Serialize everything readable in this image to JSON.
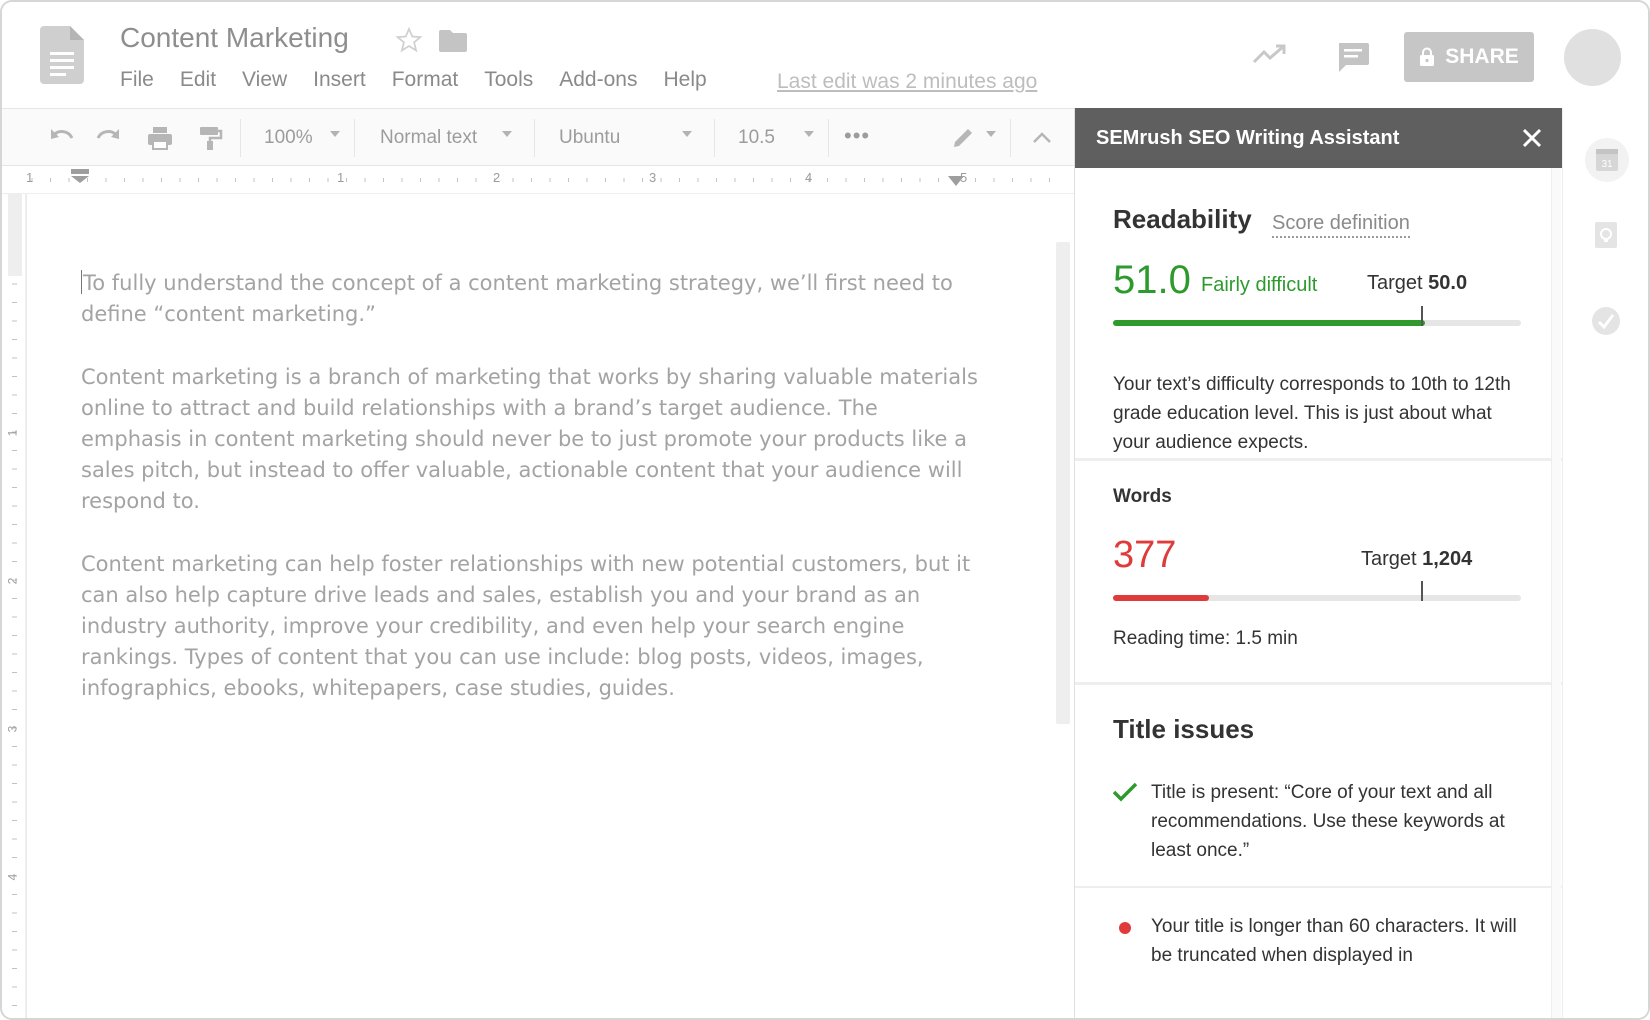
{
  "header": {
    "title": "Content Marketing",
    "menu": [
      "File",
      "Edit",
      "View",
      "Insert",
      "Format",
      "Tools",
      "Add-ons",
      "Help"
    ],
    "last_edit": "Last edit was 2 minutes ago",
    "share_label": "SHARE"
  },
  "toolbar": {
    "zoom": "100%",
    "style": "Normal text",
    "font": "Ubuntu",
    "size": "10.5",
    "more": "•••"
  },
  "ruler": {
    "numbers": [
      "1",
      "1",
      "2",
      "3",
      "4",
      "5"
    ]
  },
  "vruler": {
    "numbers": [
      "1",
      "2",
      "3",
      "4"
    ]
  },
  "document": {
    "paragraphs": [
      "To fully understand the concept of a content marketing strategy, we’ll first need to define “content marketing.”",
      "Content marketing is a branch of marketing that works by sharing valuable materials online to attract and build relationships with a brand’s target audience. The emphasis in content marketing should never be to just promote your products like a sales pitch, but instead to offer valuable, actionable content that your audience will respond to.",
      "Content marketing can help foster relationships with new potential customers, but it can also help capture drive leads and sales, establish you and your brand as an industry authority, improve your credibility, and even help your search engine rankings. Types of content that you can use include: blog posts, videos, images, infographics, ebooks, whitepapers, case studies, guides."
    ]
  },
  "panel": {
    "title": "SEMrush SEO Writing Assistant",
    "readability": {
      "heading": "Readability",
      "score_definition": "Score definition",
      "score": "51.0",
      "score_label": "Fairly difficult",
      "target_label": "Target",
      "target_value": "50.0",
      "progress": 0.765,
      "target_position": 0.755,
      "description": "Your text’s difficulty corresponds to 10th to 12th grade education level. This is just about what your audience expects."
    },
    "words": {
      "heading": "Words",
      "count": "377",
      "target_label": "Target",
      "target_value": "1,204",
      "progress": 0.235,
      "target_position": 0.755,
      "reading_time": "Reading time: 1.5 min"
    },
    "title_issues": {
      "heading": "Title issues",
      "items": [
        {
          "status": "ok",
          "text": "Title is present: “Core of your text and all recommendations. Use these keywords at least once.”"
        },
        {
          "status": "error",
          "text": "Your title is longer than 60 characters. It will be truncated when displayed in"
        }
      ]
    }
  },
  "colors": {
    "good": "#2e9a2e",
    "bad": "#e03b3b",
    "panel_header": "#5f5f5f"
  },
  "side_icons": [
    "calendar-icon",
    "keep-icon",
    "tasks-icon"
  ],
  "side_calendar_day": "31"
}
